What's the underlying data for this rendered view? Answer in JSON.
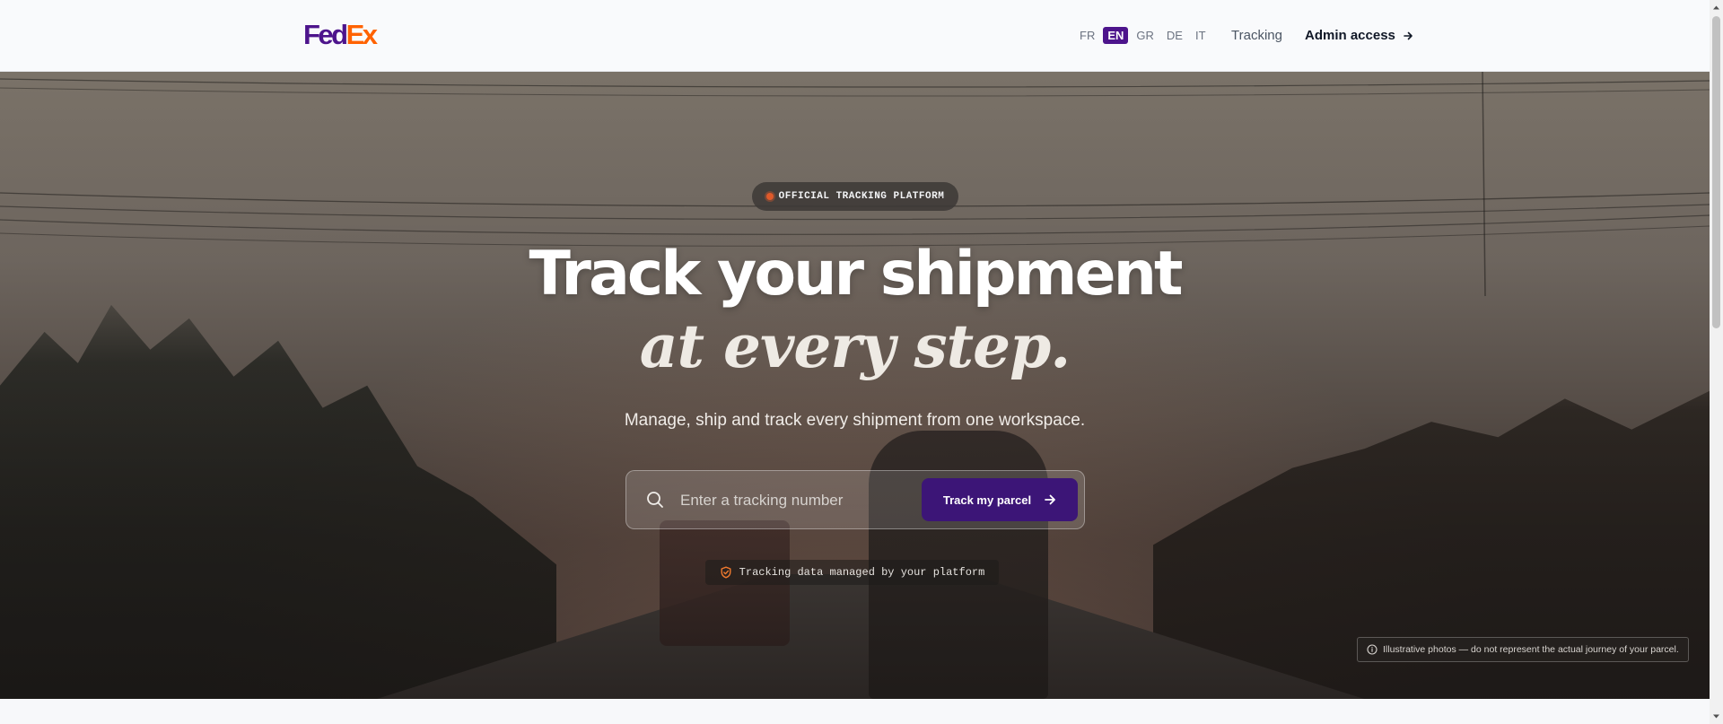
{
  "brand": {
    "logo_part1": "Fed",
    "logo_part2": "Ex"
  },
  "header": {
    "languages": [
      "FR",
      "EN",
      "GR",
      "DE",
      "IT"
    ],
    "active_language": "EN",
    "nav_tracking": "Tracking",
    "nav_admin": "Admin access"
  },
  "hero": {
    "badge": "OFFICIAL TRACKING PLATFORM",
    "title_line1": "Track your shipment",
    "title_line2": "at every step.",
    "subtitle": "Manage, ship and track every shipment from one workspace.",
    "search_placeholder": "Enter a tracking number",
    "search_value": "",
    "button_label": "Track my parcel",
    "note": "Tracking data managed by your platform",
    "disclaimer": "Illustrative photos — do not represent the actual journey of your parcel."
  },
  "colors": {
    "brand_purple": "#4d148c",
    "brand_orange": "#ff6200",
    "button_bg": "#3c1577"
  },
  "icons": {
    "search": "search-icon",
    "arrow": "arrow-right-icon",
    "shield": "shield-check-icon",
    "info": "info-icon"
  }
}
